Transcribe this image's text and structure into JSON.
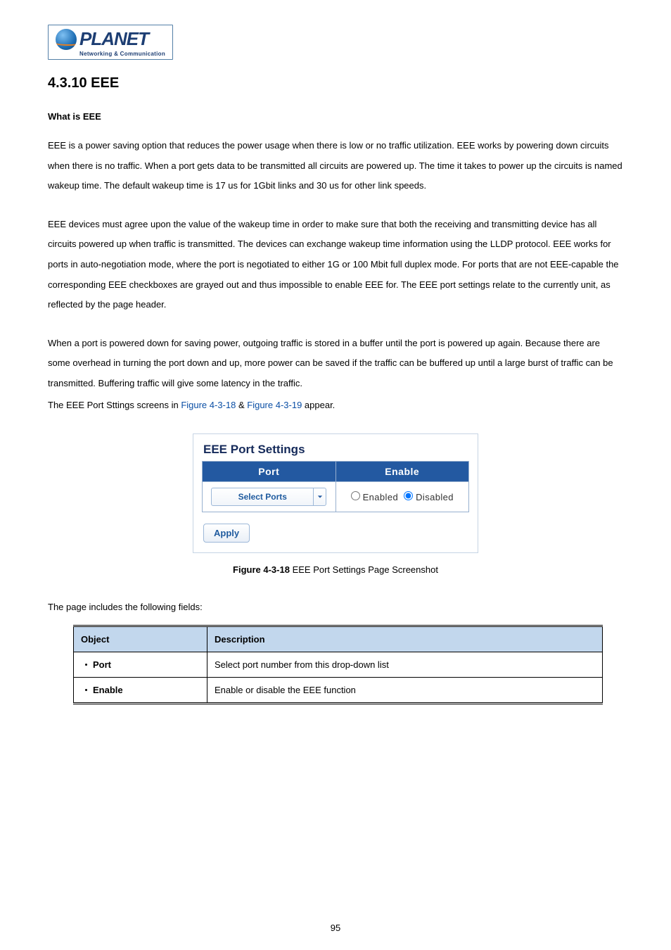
{
  "logo": {
    "brand": "PLANET",
    "tagline": "Networking & Communication"
  },
  "section": {
    "number_title": "4.3.10 EEE",
    "sub_heading": "What is EEE",
    "para1": "EEE is a power saving option that reduces the power usage when there is low or no traffic utilization. EEE works by powering down circuits when there is no traffic. When a port gets data to be transmitted all circuits are powered up. The time it takes to power up the circuits is named wakeup time. The default wakeup time is 17 us for 1Gbit links and 30 us for other link speeds.",
    "para2": "EEE devices must agree upon the value of the wakeup time in order to make sure that both the receiving and transmitting device has all circuits powered up when traffic is transmitted. The devices can exchange wakeup time information using the LLDP protocol. EEE works for ports in auto-negotiation mode, where the port is negotiated to either 1G or 100 Mbit full duplex mode. For ports that are not EEE-capable the corresponding EEE checkboxes are grayed out and thus impossible to enable EEE for. The EEE port settings relate to the currently unit, as reflected by the page header.",
    "para3": "When a port is powered down for saving power, outgoing traffic is stored in a buffer until the port is powered up again. Because there are some overhead in turning the port down and up, more power can be saved if the traffic can be buffered up until a large burst of traffic can be transmitted. Buffering traffic will give some latency in the traffic.",
    "para4_prefix": "The EEE Port Sttings screens in ",
    "para4_link1": "Figure 4-3-18",
    "para4_mid": " & ",
    "para4_link2": "Figure 4-3-19",
    "para4_suffix": " appear."
  },
  "ui_panel": {
    "title": "EEE Port Settings",
    "col_port": "Port",
    "col_enable": "Enable",
    "select_placeholder": "Select Ports",
    "radio_enabled": "Enabled",
    "radio_disabled": "Disabled",
    "radio_selected": "disabled",
    "apply_label": "Apply"
  },
  "caption": {
    "fig_label": "Figure 4-3-18",
    "fig_text": " EEE Port Settings Page Screenshot"
  },
  "fields_intro": "The page includes the following fields:",
  "fields_table": {
    "head_object": "Object",
    "head_desc": "Description",
    "rows": [
      {
        "object": "Port",
        "desc": "Select port number from this drop-down list"
      },
      {
        "object": "Enable",
        "desc": "Enable or disable the EEE function"
      }
    ]
  },
  "page_number": "95"
}
